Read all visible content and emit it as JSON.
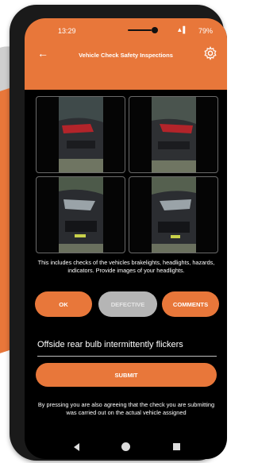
{
  "status_bar": {
    "time": "13:29",
    "battery": "79%"
  },
  "header": {
    "title": "Vehicle Check Safety Inspections"
  },
  "photos": [
    {
      "description": "rear left light"
    },
    {
      "description": "rear right light"
    },
    {
      "description": "front left headlight"
    },
    {
      "description": "front right headlight"
    }
  ],
  "description": "This includes checks of the vehicles brakelights, headlights, hazards, indicators. Provide images of your headlights.",
  "buttons": {
    "ok": "OK",
    "defective": "DEFECTIVE",
    "comments": "COMMENTS"
  },
  "comment_input": {
    "value": "Offside rear bulb intermittently flickers"
  },
  "submit_label": "SUBMIT",
  "footer_text": "By pressing you are also agreeing that the check you are submitting was carried out on the actual vehicle assigned",
  "colors": {
    "accent": "#e8773a",
    "disabled": "#b5b5b5",
    "background": "#000000"
  }
}
